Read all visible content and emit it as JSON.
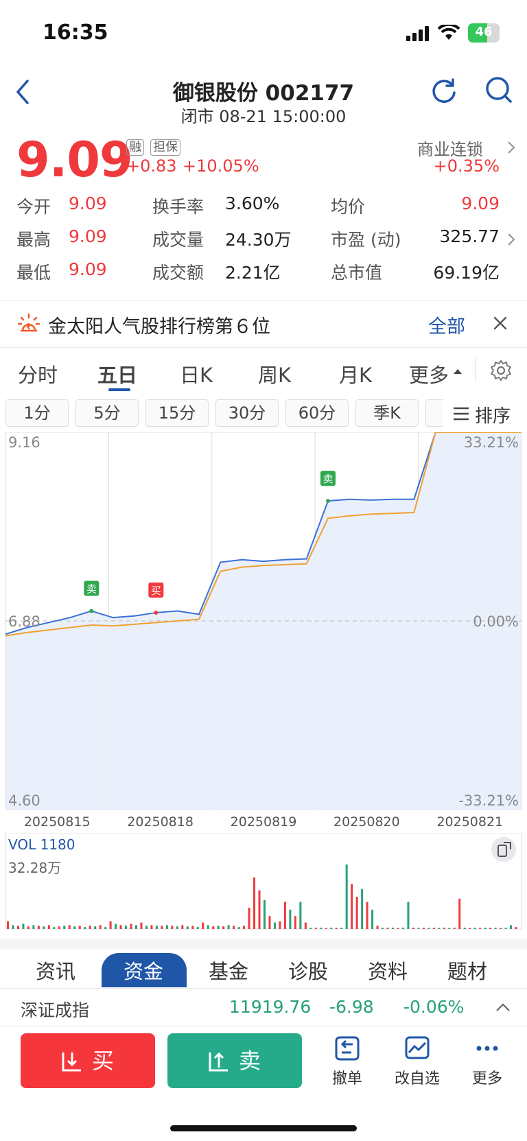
{
  "status": {
    "time": "16:35",
    "battery": "46"
  },
  "header": {
    "title": "御银股份 002177",
    "subtitle": "闭市 08-21 15:00:00"
  },
  "quote": {
    "price": "9.09",
    "tag_margin": "融",
    "tag_guarantee": "担保",
    "change": "+0.83",
    "change_pct": "+10.05%",
    "sector_name": "商业连锁",
    "sector_change": "+0.35%"
  },
  "stats": [
    {
      "label": "今开",
      "value": "9.09"
    },
    {
      "label": "换手率",
      "value": "3.60%"
    },
    {
      "label": "均价",
      "value": "9.09"
    },
    {
      "label": "最高",
      "value": "9.09"
    },
    {
      "label": "成交量",
      "value": "24.30万"
    },
    {
      "label": "市盈 (动)",
      "value": "325.77"
    },
    {
      "label": "最低",
      "value": "9.09"
    },
    {
      "label": "成交额",
      "value": "2.21亿"
    },
    {
      "label": "总市值",
      "value": "69.19亿"
    }
  ],
  "banner": {
    "text": "金太阳人气股排行榜第６位",
    "link": "全部"
  },
  "tabs": [
    "分时",
    "五日",
    "日K",
    "周K",
    "月K",
    "更多"
  ],
  "active_tab": "五日",
  "subtabs": [
    "1分",
    "5分",
    "15分",
    "30分",
    "60分",
    "季K"
  ],
  "sort_label": "排序",
  "chart_data": {
    "type": "line",
    "x": [
      "20250815",
      "20250818",
      "20250819",
      "20250820",
      "20250821"
    ],
    "ylim": [
      4.6,
      9.16
    ],
    "y_left_labels": [
      "9.16",
      "6.88",
      "4.60"
    ],
    "y_right_labels": [
      "33.21%",
      "0.00%",
      "-33.21%"
    ],
    "baseline": 6.88,
    "series": [
      {
        "color": "#3b6fd8",
        "values": [
          6.72,
          6.8,
          6.86,
          6.92,
          7.0,
          6.92,
          6.94,
          6.98,
          7.0,
          6.96,
          7.59,
          7.62,
          7.6,
          7.62,
          7.63,
          8.33,
          8.35,
          8.34,
          8.35,
          8.35,
          9.16,
          9.16,
          9.16,
          9.16,
          9.16
        ]
      },
      {
        "color": "#f0a030",
        "values": [
          6.7,
          6.74,
          6.77,
          6.8,
          6.83,
          6.82,
          6.84,
          6.86,
          6.88,
          6.9,
          7.48,
          7.53,
          7.55,
          7.56,
          7.57,
          8.12,
          8.15,
          8.17,
          8.18,
          8.19,
          9.16,
          9.16,
          9.16,
          9.16,
          9.16
        ]
      }
    ],
    "markers": [
      {
        "label": "卖",
        "index": 4,
        "color": "#2fa84f"
      },
      {
        "label": "买",
        "index": 7,
        "color": "#f0393c"
      },
      {
        "label": "卖",
        "index": 15,
        "color": "#2fa84f"
      }
    ],
    "volume": {
      "label": "VOL 1180",
      "max_label": "32.28万",
      "bars": [
        [
          0,
          0.12,
          "red"
        ],
        [
          1,
          0.06,
          "green"
        ],
        [
          2,
          0.05,
          "red"
        ],
        [
          3,
          0.08,
          "green"
        ],
        [
          4,
          0.04,
          "red"
        ],
        [
          5,
          0.06,
          "green"
        ],
        [
          6,
          0.05,
          "red"
        ],
        [
          7,
          0.04,
          "green"
        ],
        [
          8,
          0.06,
          "red"
        ],
        [
          9,
          0.03,
          "green"
        ],
        [
          10,
          0.04,
          "red"
        ],
        [
          11,
          0.05,
          "green"
        ],
        [
          12,
          0.06,
          "red"
        ],
        [
          13,
          0.04,
          "green"
        ],
        [
          14,
          0.05,
          "red"
        ],
        [
          15,
          0.03,
          "green"
        ],
        [
          16,
          0.05,
          "red"
        ],
        [
          17,
          0.04,
          "green"
        ],
        [
          18,
          0.06,
          "red"
        ],
        [
          19,
          0.03,
          "green"
        ],
        [
          20,
          0.12,
          "red"
        ],
        [
          21,
          0.08,
          "green"
        ],
        [
          22,
          0.06,
          "red"
        ],
        [
          23,
          0.05,
          "green"
        ],
        [
          24,
          0.08,
          "red"
        ],
        [
          25,
          0.06,
          "green"
        ],
        [
          26,
          0.1,
          "red"
        ],
        [
          27,
          0.05,
          "green"
        ],
        [
          28,
          0.06,
          "red"
        ],
        [
          29,
          0.05,
          "green"
        ],
        [
          30,
          0.05,
          "red"
        ],
        [
          31,
          0.06,
          "green"
        ],
        [
          32,
          0.05,
          "red"
        ],
        [
          33,
          0.04,
          "green"
        ],
        [
          34,
          0.06,
          "red"
        ],
        [
          35,
          0.04,
          "green"
        ],
        [
          36,
          0.05,
          "red"
        ],
        [
          37,
          0.03,
          "green"
        ],
        [
          38,
          0.1,
          "red"
        ],
        [
          39,
          0.06,
          "green"
        ],
        [
          40,
          0.04,
          "red"
        ],
        [
          41,
          0.05,
          "green"
        ],
        [
          42,
          0.04,
          "red"
        ],
        [
          43,
          0.06,
          "green"
        ],
        [
          44,
          0.05,
          "red"
        ],
        [
          45,
          0.03,
          "green"
        ],
        [
          46,
          0.05,
          "red"
        ],
        [
          47,
          0.33,
          "red"
        ],
        [
          48,
          0.8,
          "red"
        ],
        [
          49,
          0.6,
          "red"
        ],
        [
          50,
          0.45,
          "green"
        ],
        [
          51,
          0.2,
          "red"
        ],
        [
          52,
          0.1,
          "green"
        ],
        [
          53,
          0.12,
          "red"
        ],
        [
          54,
          0.42,
          "red"
        ],
        [
          55,
          0.3,
          "green"
        ],
        [
          56,
          0.2,
          "red"
        ],
        [
          57,
          0.42,
          "green"
        ],
        [
          58,
          0.1,
          "red"
        ],
        [
          59,
          0.02,
          "green"
        ],
        [
          60,
          0.02,
          "red"
        ],
        [
          61,
          0.02,
          "green"
        ],
        [
          62,
          0.01,
          "red"
        ],
        [
          63,
          0.02,
          "green"
        ],
        [
          64,
          0.01,
          "red"
        ],
        [
          65,
          0.02,
          "green"
        ],
        [
          66,
          1.0,
          "green"
        ],
        [
          67,
          0.7,
          "red"
        ],
        [
          68,
          0.5,
          "red"
        ],
        [
          69,
          0.62,
          "green"
        ],
        [
          70,
          0.42,
          "red"
        ],
        [
          71,
          0.3,
          "green"
        ],
        [
          72,
          0.05,
          "red"
        ],
        [
          73,
          0.02,
          "green"
        ],
        [
          74,
          0.02,
          "red"
        ],
        [
          75,
          0.02,
          "green"
        ],
        [
          76,
          0.01,
          "red"
        ],
        [
          77,
          0.02,
          "green"
        ],
        [
          78,
          0.42,
          "green"
        ],
        [
          79,
          0.02,
          "red"
        ],
        [
          80,
          0.01,
          "green"
        ],
        [
          81,
          0.02,
          "red"
        ],
        [
          82,
          0.01,
          "green"
        ],
        [
          83,
          0.02,
          "red"
        ],
        [
          84,
          0.01,
          "green"
        ],
        [
          85,
          0.02,
          "red"
        ],
        [
          86,
          0.01,
          "green"
        ],
        [
          87,
          0.02,
          "red"
        ],
        [
          88,
          0.47,
          "red"
        ],
        [
          89,
          0.02,
          "green"
        ],
        [
          90,
          0.01,
          "red"
        ],
        [
          91,
          0.02,
          "green"
        ],
        [
          92,
          0.01,
          "red"
        ],
        [
          93,
          0.02,
          "green"
        ],
        [
          94,
          0.01,
          "red"
        ],
        [
          95,
          0.02,
          "green"
        ],
        [
          96,
          0.01,
          "red"
        ],
        [
          97,
          0.02,
          "green"
        ],
        [
          98,
          0.06,
          "green"
        ],
        [
          99,
          0.03,
          "red"
        ]
      ]
    }
  },
  "bottom_tabs": [
    "资讯",
    "资金",
    "基金",
    "诊股",
    "资料",
    "题材"
  ],
  "active_bottom_tab": "资金",
  "index": {
    "name": "深证成指",
    "value": "11919.76",
    "change": "-6.98",
    "change_pct": "-0.06%"
  },
  "actions": {
    "buy": "买",
    "sell": "卖",
    "cancel": "撤单",
    "watchlist": "改自选",
    "more": "更多"
  },
  "colors": {
    "up": "#f0393c",
    "down": "#26a17b",
    "accent": "#1f56a8"
  }
}
